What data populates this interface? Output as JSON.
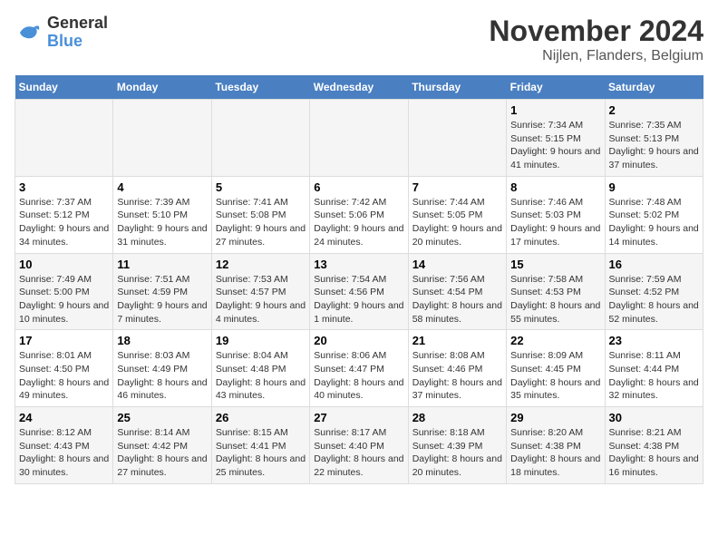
{
  "header": {
    "logo_general": "General",
    "logo_blue": "Blue",
    "title": "November 2024",
    "subtitle": "Nijlen, Flanders, Belgium"
  },
  "weekdays": [
    "Sunday",
    "Monday",
    "Tuesday",
    "Wednesday",
    "Thursday",
    "Friday",
    "Saturday"
  ],
  "weeks": [
    [
      {
        "day": "",
        "info": ""
      },
      {
        "day": "",
        "info": ""
      },
      {
        "day": "",
        "info": ""
      },
      {
        "day": "",
        "info": ""
      },
      {
        "day": "",
        "info": ""
      },
      {
        "day": "1",
        "info": "Sunrise: 7:34 AM\nSunset: 5:15 PM\nDaylight: 9 hours and 41 minutes."
      },
      {
        "day": "2",
        "info": "Sunrise: 7:35 AM\nSunset: 5:13 PM\nDaylight: 9 hours and 37 minutes."
      }
    ],
    [
      {
        "day": "3",
        "info": "Sunrise: 7:37 AM\nSunset: 5:12 PM\nDaylight: 9 hours and 34 minutes."
      },
      {
        "day": "4",
        "info": "Sunrise: 7:39 AM\nSunset: 5:10 PM\nDaylight: 9 hours and 31 minutes."
      },
      {
        "day": "5",
        "info": "Sunrise: 7:41 AM\nSunset: 5:08 PM\nDaylight: 9 hours and 27 minutes."
      },
      {
        "day": "6",
        "info": "Sunrise: 7:42 AM\nSunset: 5:06 PM\nDaylight: 9 hours and 24 minutes."
      },
      {
        "day": "7",
        "info": "Sunrise: 7:44 AM\nSunset: 5:05 PM\nDaylight: 9 hours and 20 minutes."
      },
      {
        "day": "8",
        "info": "Sunrise: 7:46 AM\nSunset: 5:03 PM\nDaylight: 9 hours and 17 minutes."
      },
      {
        "day": "9",
        "info": "Sunrise: 7:48 AM\nSunset: 5:02 PM\nDaylight: 9 hours and 14 minutes."
      }
    ],
    [
      {
        "day": "10",
        "info": "Sunrise: 7:49 AM\nSunset: 5:00 PM\nDaylight: 9 hours and 10 minutes."
      },
      {
        "day": "11",
        "info": "Sunrise: 7:51 AM\nSunset: 4:59 PM\nDaylight: 9 hours and 7 minutes."
      },
      {
        "day": "12",
        "info": "Sunrise: 7:53 AM\nSunset: 4:57 PM\nDaylight: 9 hours and 4 minutes."
      },
      {
        "day": "13",
        "info": "Sunrise: 7:54 AM\nSunset: 4:56 PM\nDaylight: 9 hours and 1 minute."
      },
      {
        "day": "14",
        "info": "Sunrise: 7:56 AM\nSunset: 4:54 PM\nDaylight: 8 hours and 58 minutes."
      },
      {
        "day": "15",
        "info": "Sunrise: 7:58 AM\nSunset: 4:53 PM\nDaylight: 8 hours and 55 minutes."
      },
      {
        "day": "16",
        "info": "Sunrise: 7:59 AM\nSunset: 4:52 PM\nDaylight: 8 hours and 52 minutes."
      }
    ],
    [
      {
        "day": "17",
        "info": "Sunrise: 8:01 AM\nSunset: 4:50 PM\nDaylight: 8 hours and 49 minutes."
      },
      {
        "day": "18",
        "info": "Sunrise: 8:03 AM\nSunset: 4:49 PM\nDaylight: 8 hours and 46 minutes."
      },
      {
        "day": "19",
        "info": "Sunrise: 8:04 AM\nSunset: 4:48 PM\nDaylight: 8 hours and 43 minutes."
      },
      {
        "day": "20",
        "info": "Sunrise: 8:06 AM\nSunset: 4:47 PM\nDaylight: 8 hours and 40 minutes."
      },
      {
        "day": "21",
        "info": "Sunrise: 8:08 AM\nSunset: 4:46 PM\nDaylight: 8 hours and 37 minutes."
      },
      {
        "day": "22",
        "info": "Sunrise: 8:09 AM\nSunset: 4:45 PM\nDaylight: 8 hours and 35 minutes."
      },
      {
        "day": "23",
        "info": "Sunrise: 8:11 AM\nSunset: 4:44 PM\nDaylight: 8 hours and 32 minutes."
      }
    ],
    [
      {
        "day": "24",
        "info": "Sunrise: 8:12 AM\nSunset: 4:43 PM\nDaylight: 8 hours and 30 minutes."
      },
      {
        "day": "25",
        "info": "Sunrise: 8:14 AM\nSunset: 4:42 PM\nDaylight: 8 hours and 27 minutes."
      },
      {
        "day": "26",
        "info": "Sunrise: 8:15 AM\nSunset: 4:41 PM\nDaylight: 8 hours and 25 minutes."
      },
      {
        "day": "27",
        "info": "Sunrise: 8:17 AM\nSunset: 4:40 PM\nDaylight: 8 hours and 22 minutes."
      },
      {
        "day": "28",
        "info": "Sunrise: 8:18 AM\nSunset: 4:39 PM\nDaylight: 8 hours and 20 minutes."
      },
      {
        "day": "29",
        "info": "Sunrise: 8:20 AM\nSunset: 4:38 PM\nDaylight: 8 hours and 18 minutes."
      },
      {
        "day": "30",
        "info": "Sunrise: 8:21 AM\nSunset: 4:38 PM\nDaylight: 8 hours and 16 minutes."
      }
    ]
  ]
}
